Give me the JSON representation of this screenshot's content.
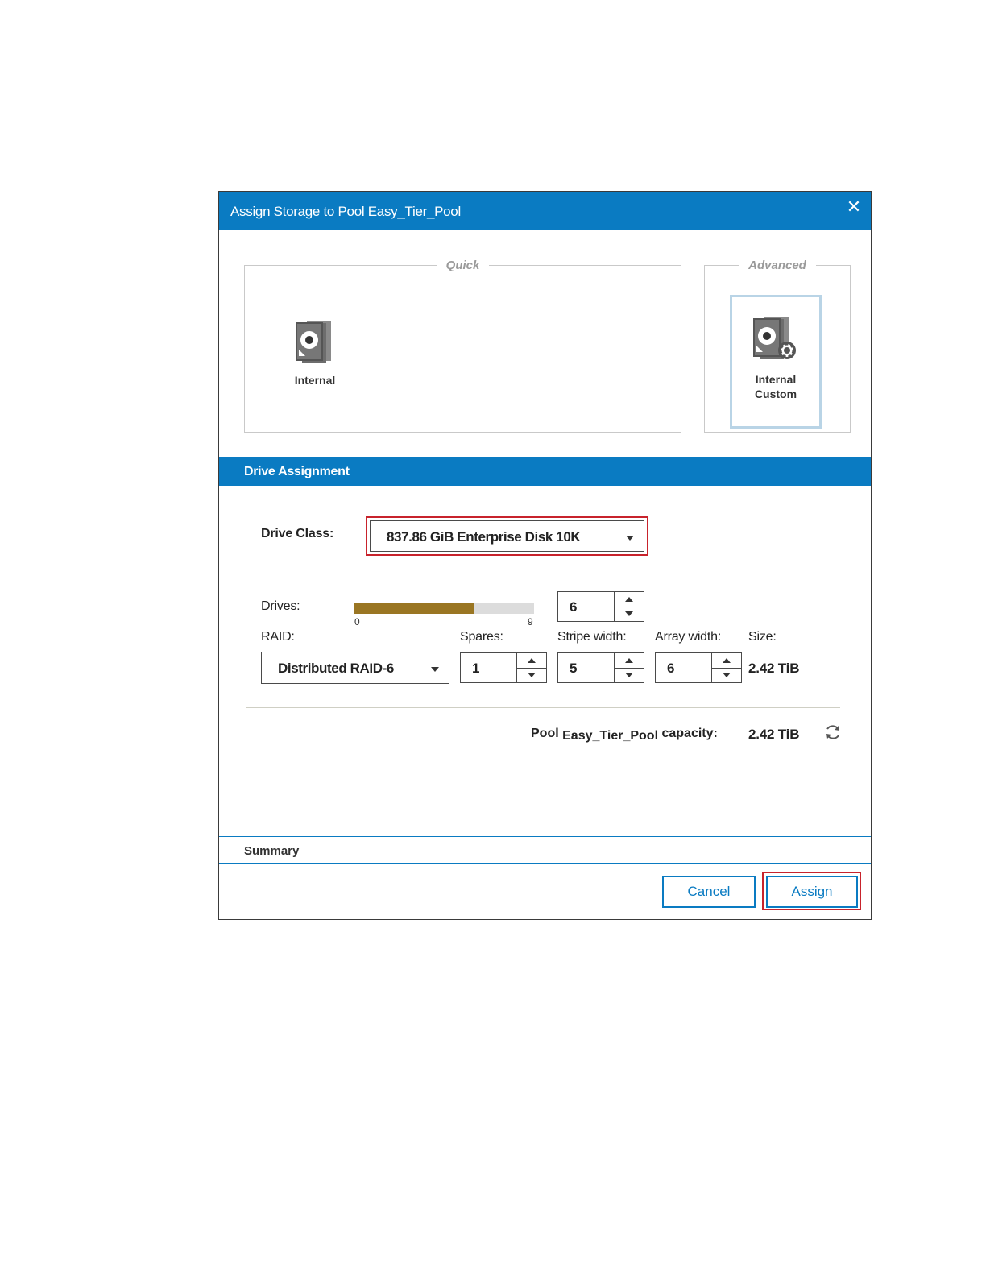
{
  "dialog": {
    "title": "Assign Storage to Pool Easy_Tier_Pool",
    "close_label": "✕"
  },
  "quick": {
    "legend": "Quick",
    "internal_label": "Internal"
  },
  "advanced": {
    "legend": "Advanced",
    "custom_label_1": "Internal",
    "custom_label_2": "Custom"
  },
  "drive_assignment": {
    "section_title": "Drive Assignment",
    "drive_class_label": "Drive Class:",
    "drive_class_value": "837.86 GiB Enterprise Disk 10K",
    "drives_label": "Drives:",
    "drives_value": "6",
    "drives_slider": {
      "min": "0",
      "max": "9",
      "fill_fraction": 0.67
    },
    "raid_label": "RAID:",
    "raid_value": "Distributed RAID-6",
    "spares_label": "Spares:",
    "spares_value": "1",
    "stripe_label": "Stripe width:",
    "stripe_value": "5",
    "array_label": "Array width:",
    "array_value": "6",
    "size_label": "Size:",
    "size_value": "2.42 TiB",
    "capacity_label_pre": "Pool",
    "capacity_pool": "Easy_Tier_Pool",
    "capacity_label_post": "capacity:",
    "capacity_value": "2.42 TiB"
  },
  "summary": {
    "label": "Summary"
  },
  "buttons": {
    "cancel": "Cancel",
    "assign": "Assign"
  },
  "colors": {
    "accent": "#0a7bc2",
    "highlight": "#c8232c",
    "slider_fill": "#9a7623"
  },
  "icons": {
    "internal": "disk-stack-icon",
    "custom": "disk-gear-icon",
    "refresh": "refresh-icon"
  }
}
